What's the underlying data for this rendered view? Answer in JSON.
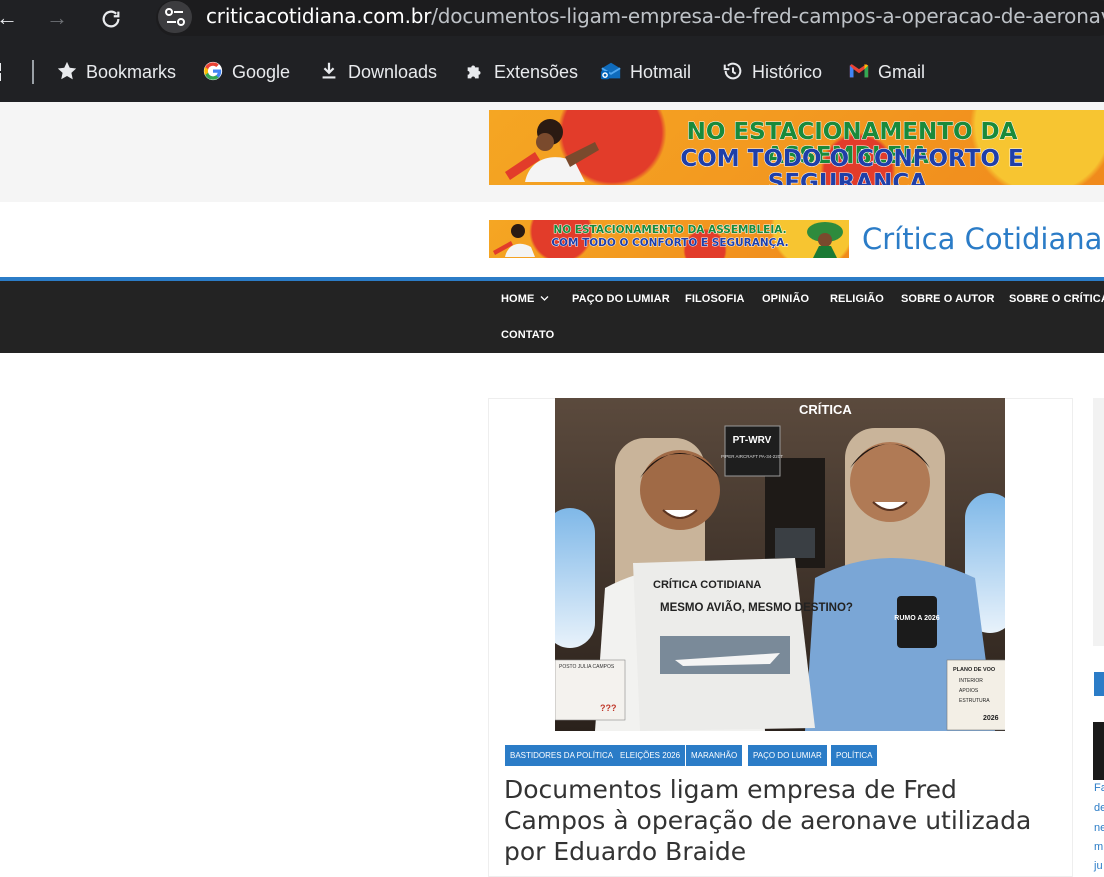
{
  "browser": {
    "url_domain": "criticacotidiana.com.br",
    "url_path": "/documentos-ligam-empresa-de-fred-campos-a-operacao-de-aeronave-ut",
    "nav_back": "←",
    "nav_forward": "→",
    "nav_reload": "⟳",
    "site_info_icon": "site-settings-icon",
    "bookmarks": [
      {
        "label": "Bookmarks",
        "icon": "star-icon"
      },
      {
        "label": "Google",
        "icon": "google-icon"
      },
      {
        "label": "Downloads",
        "icon": "download-icon"
      },
      {
        "label": "Extensões",
        "icon": "puzzle-icon"
      },
      {
        "label": "Hotmail",
        "icon": "hotmail-icon"
      },
      {
        "label": "Histórico",
        "icon": "history-icon"
      },
      {
        "label": "Gmail",
        "icon": "gmail-icon"
      }
    ]
  },
  "page": {
    "banner": {
      "line1": "NO ESTACIONAMENTO DA ASSEMBLEIA.",
      "line2": "COM TODO O CONFORTO E SEGURANÇA."
    },
    "site_title": "Crítica Cotidiana",
    "menu": [
      "HOME",
      "PAÇO DO LUMIAR",
      "FILOSOFIA",
      "OPINIÃO",
      "RELIGIÃO",
      "SOBRE O AUTOR",
      "SOBRE O CRÍTICA C",
      "CONTATO"
    ],
    "article": {
      "image": {
        "brand": "CRÍTICA",
        "tail_number": "PT-WRV",
        "aircraft": "PIPER AIRCRAFT PA-34-220T",
        "newspaper_masthead": "CRÍTICA COTIDIANA",
        "newspaper_headline": "MESMO AVIÃO, MESMO DESTINO?",
        "mug_text": "RUMO A 2026",
        "notepad_title": "PLANO DE VOO",
        "notepad_items": [
          "INTERIOR",
          "APOIOS",
          "ESTRUTURA"
        ],
        "notepad_year": "2026",
        "receipt_title": "POSTO JULIA CAMPOS",
        "receipt_marks": "???"
      },
      "categories": [
        "BASTIDORES DA POLÍTICA",
        "ELEIÇÕES 2026",
        "MARANHÃO",
        "PAÇO DO LUMIAR",
        "POLÍTICA"
      ],
      "headline": "Documentos ligam empresa de Fred Campos à operação de aeronave utilizada por Eduardo Braide"
    },
    "sidebar_fragments": [
      "Fa",
      "de",
      "ne",
      "m",
      "ju"
    ]
  }
}
